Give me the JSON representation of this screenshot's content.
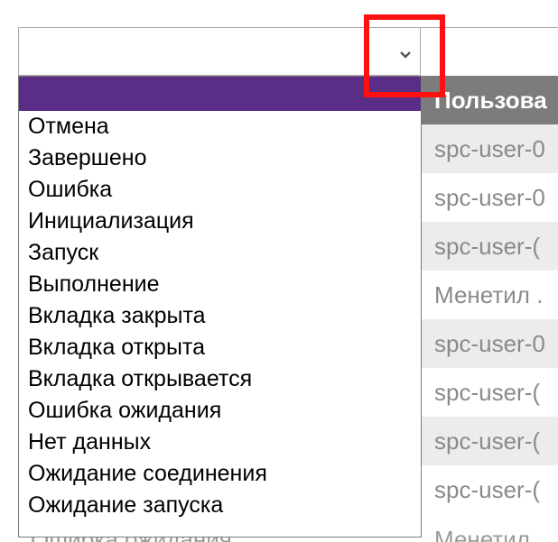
{
  "filter": {
    "selected_value": "",
    "options": [
      "Отмена",
      "Завершено",
      "Ошибка",
      "Инициализация",
      "Запуск",
      "Выполнение",
      "Вкладка закрыта",
      "Вкладка открыта",
      "Вкладка открывается",
      "Ошибка ожидания",
      "Нет данных",
      "Ожидание соединения",
      "Ожидание запуска"
    ]
  },
  "table": {
    "user_column_header": "Пользова",
    "rows": [
      "spc-user-0",
      "spc-user-0",
      "spc-user-(",
      "Менетил .",
      "spc-user-0",
      "spc-user-(",
      "spc-user-(",
      "spc-user-("
    ],
    "partial_bottom_row": {
      "status": "Ошибка ожидания",
      "user": "Менетил"
    }
  },
  "colors": {
    "header_purple": "#5a2d86",
    "highlight_red": "#ff1010",
    "header_gray": "#7c7c7c"
  },
  "icons": {
    "dropdown_arrow": "chevron-down-icon"
  }
}
